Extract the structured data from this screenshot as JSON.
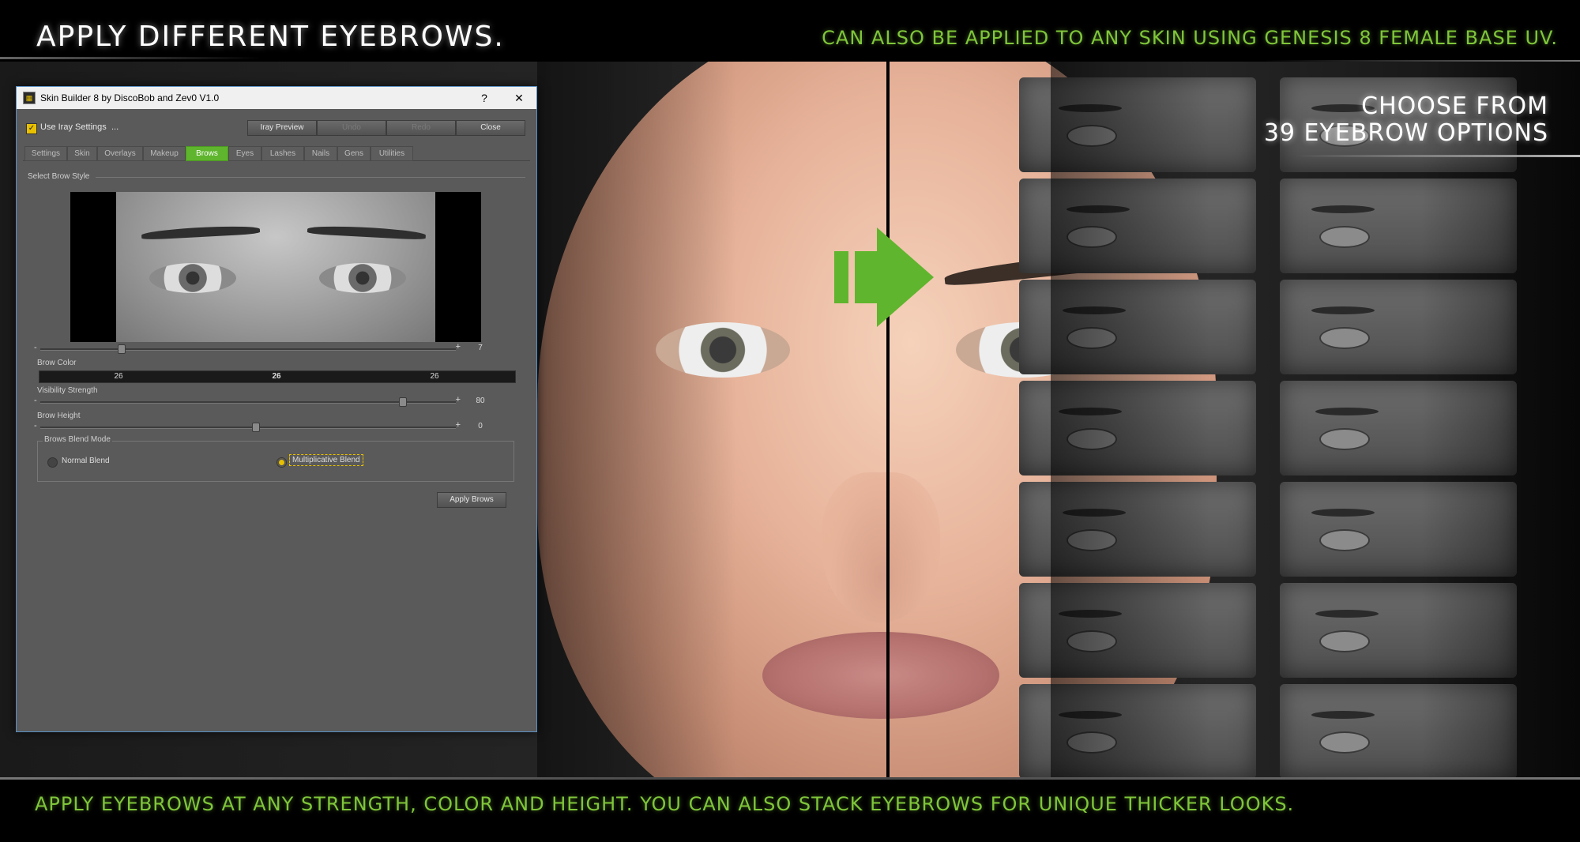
{
  "banner": {
    "headline": "Apply different eyebrows.",
    "top_right": "Can also be applied to any skin using Genesis 8 Female base UV.",
    "choose_line1": "Choose from",
    "choose_line2": "39 eyebrow options",
    "bottom": "Apply eyebrows at any strength, color and height. You can also stack eyebrows for unique thicker looks."
  },
  "colors": {
    "accent_green": "#7fc63a",
    "tab_active": "#5fb52d",
    "highlight_yellow": "#e8c000"
  },
  "dialog": {
    "title": "Skin Builder 8 by DiscoBob and Zev0 V1.0",
    "help_label": "?",
    "close_label": "✕",
    "use_iray_label": "Use Iray Settings",
    "use_iray_checked": true,
    "ellipsis": "...",
    "buttons": {
      "iray_preview": "Iray Preview",
      "undo": "Undo",
      "redo": "Redo",
      "close": "Close"
    },
    "tabs": [
      "Settings",
      "Skin",
      "Overlays",
      "Makeup",
      "Brows",
      "Eyes",
      "Lashes",
      "Nails",
      "Gens",
      "Utilities"
    ],
    "active_tab": "Brows",
    "select_brow_style": "Select Brow Style",
    "brow_style_value": "7",
    "brow_color_label": "Brow Color",
    "brow_color": [
      "26",
      "26",
      "26"
    ],
    "visibility_label": "Visibility Strength",
    "visibility_value": "80",
    "height_label": "Brow Height",
    "height_value": "0",
    "blend_mode_label": "Brows Blend Mode",
    "blend_normal": "Normal Blend",
    "blend_multiplicative": "Multiplicative Blend",
    "blend_selected": "Multiplicative Blend",
    "apply_label": "Apply Brows",
    "slider_minus": "-",
    "slider_plus": "+"
  }
}
